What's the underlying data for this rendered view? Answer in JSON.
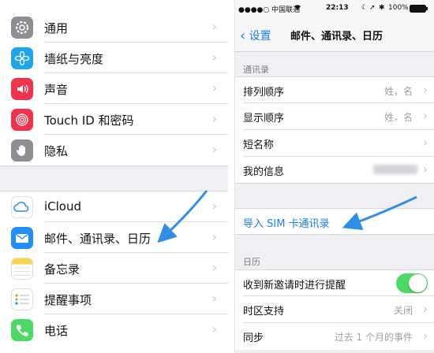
{
  "left_panel": {
    "group1": [
      {
        "label": "通用",
        "icon": "gear-icon",
        "color": "#8e8e93"
      },
      {
        "label": "墙纸与亮度",
        "icon": "flower-icon",
        "color": "#1fa6e8"
      },
      {
        "label": "声音",
        "icon": "speaker-icon",
        "color": "#f0344c"
      },
      {
        "label": "Touch ID 和密码",
        "icon": "fingerprint-icon",
        "color": "#f0344c"
      },
      {
        "label": "隐私",
        "icon": "hand-icon",
        "color": "#8e8e93"
      }
    ],
    "group2": [
      {
        "label": "iCloud",
        "icon": "cloud-icon",
        "color": "#ffffff"
      },
      {
        "label": "邮件、通讯录、日历",
        "icon": "mail-icon",
        "color": "#1f8ef5"
      },
      {
        "label": "备忘录",
        "icon": "notes-icon",
        "color": "#f8d548"
      },
      {
        "label": "提醒事项",
        "icon": "list-icon",
        "color": "#ffffff"
      },
      {
        "label": "电话",
        "icon": "phone-icon",
        "color": "#4cd964"
      }
    ]
  },
  "right_panel": {
    "status_bar": {
      "carrier": "●●●●○ 中国联通",
      "time": "22:13",
      "battery": "100%"
    },
    "nav": {
      "back_label": "设置",
      "title": "邮件、通讯录、日历"
    },
    "contacts_section": {
      "header": "通讯录",
      "rows": [
        {
          "label": "排列顺序",
          "value": "姓，名"
        },
        {
          "label": "显示顺序",
          "value": "姓，名"
        },
        {
          "label": "短名称",
          "value": ""
        },
        {
          "label": "我的信息",
          "value": ""
        }
      ],
      "import_link": "导入 SIM 卡通讯录"
    },
    "calendar_section": {
      "header": "日历",
      "rows": [
        {
          "label": "收到新邀请时进行提醒",
          "toggle": true
        },
        {
          "label": "时区支持",
          "value": "关闭"
        },
        {
          "label": "同步",
          "value": "过去 1 个月的事件"
        }
      ]
    }
  }
}
